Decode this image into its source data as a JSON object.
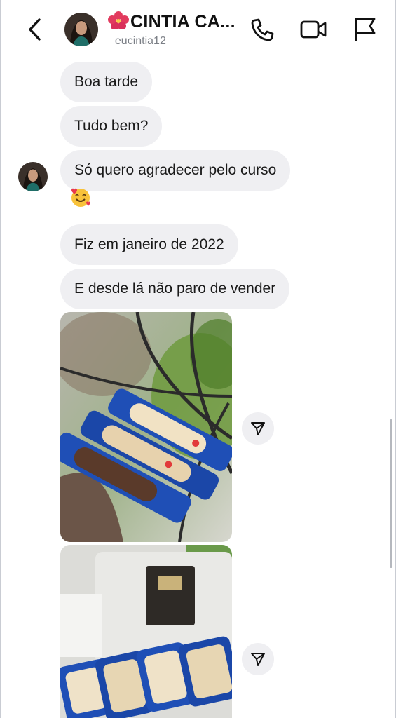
{
  "header": {
    "name": "CINTIA CA...",
    "username": "_eucintia12"
  },
  "icons": {
    "back": "chevron-left-icon",
    "call": "phone-icon",
    "video": "video-camera-icon",
    "flag": "flag-icon",
    "flower": "hibiscus-emoji",
    "emoji": "smiling-face-with-hearts-emoji",
    "share": "send-arrow-icon"
  },
  "messages": [
    {
      "text": "Boa tarde"
    },
    {
      "text": "Tudo bem?"
    },
    {
      "text": "Só quero agradecer pelo curso"
    },
    {
      "text": "Fiz em janeiro de 2022"
    },
    {
      "text": "E desde lá não paro de vender"
    }
  ],
  "colors": {
    "bubble": "#efeff2",
    "muted_text": "#7b7f86",
    "wrapper_blue": "#1f4fb6"
  }
}
